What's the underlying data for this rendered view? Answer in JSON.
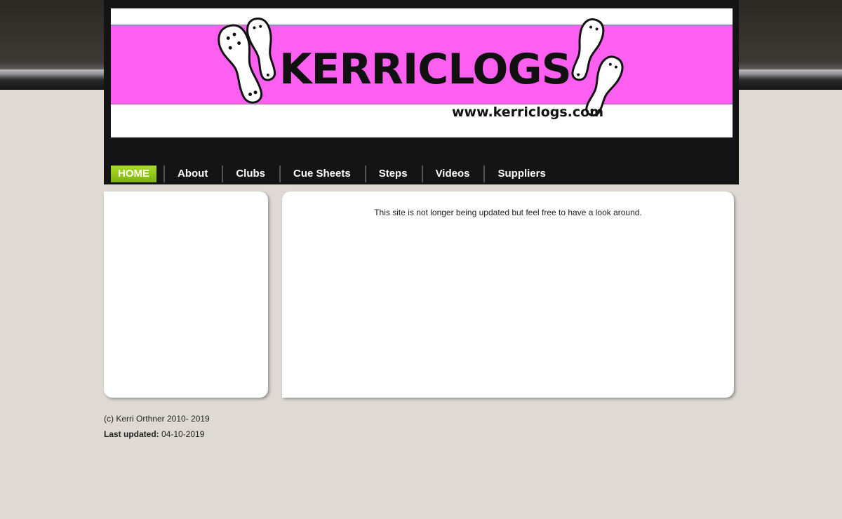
{
  "header": {
    "logo_text": "KERRICLOGS",
    "logo_url": "www.kerriclogs.com"
  },
  "nav": {
    "items": [
      {
        "label": "HOME"
      },
      {
        "label": "About"
      },
      {
        "label": "Clubs"
      },
      {
        "label": "Cue Sheets"
      },
      {
        "label": "Steps"
      },
      {
        "label": "Videos"
      },
      {
        "label": "Suppliers"
      }
    ]
  },
  "main": {
    "notice": "This site is not longer being updated but feel free to have a look around."
  },
  "footer": {
    "copyright": "(c) Kerri Orthner 2010- 2019",
    "last_updated_label": "Last updated:",
    "last_updated_value": "04-10-2019"
  },
  "colors": {
    "banner_pink": "#fd5ff0",
    "nav_active_green": "#8cc41a",
    "page_bg": "#dedad3",
    "header_dark": "#141414"
  },
  "icons": [
    "clog-sole-icon"
  ]
}
